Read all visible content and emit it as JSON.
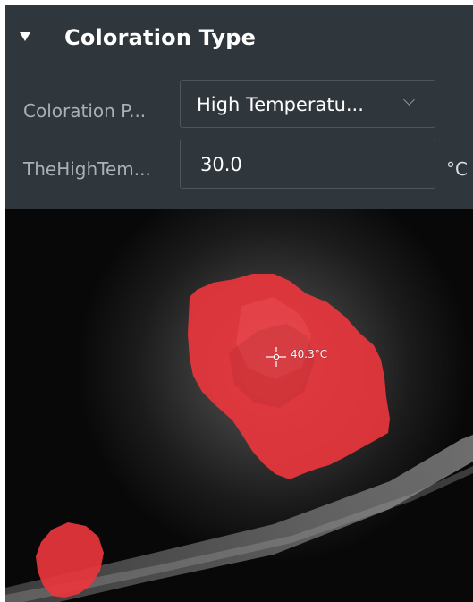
{
  "section": {
    "title": "Coloration Type",
    "collapse_icon": "triangle-down-icon"
  },
  "fields": {
    "palette_label": "Coloration P...",
    "palette_value": "High Temperatu...",
    "threshold_label": "TheHighTem...",
    "threshold_value": "30.0",
    "threshold_unit": "°C"
  },
  "thermal_view": {
    "spot_temperature": "40.3°C",
    "crosshair_icon": "crosshair-icon",
    "highlight_color": "#e8363d"
  },
  "colors": {
    "panel_background": "#2f363c",
    "input_border": "#4e565d",
    "label_text": "#a9b0b6"
  }
}
